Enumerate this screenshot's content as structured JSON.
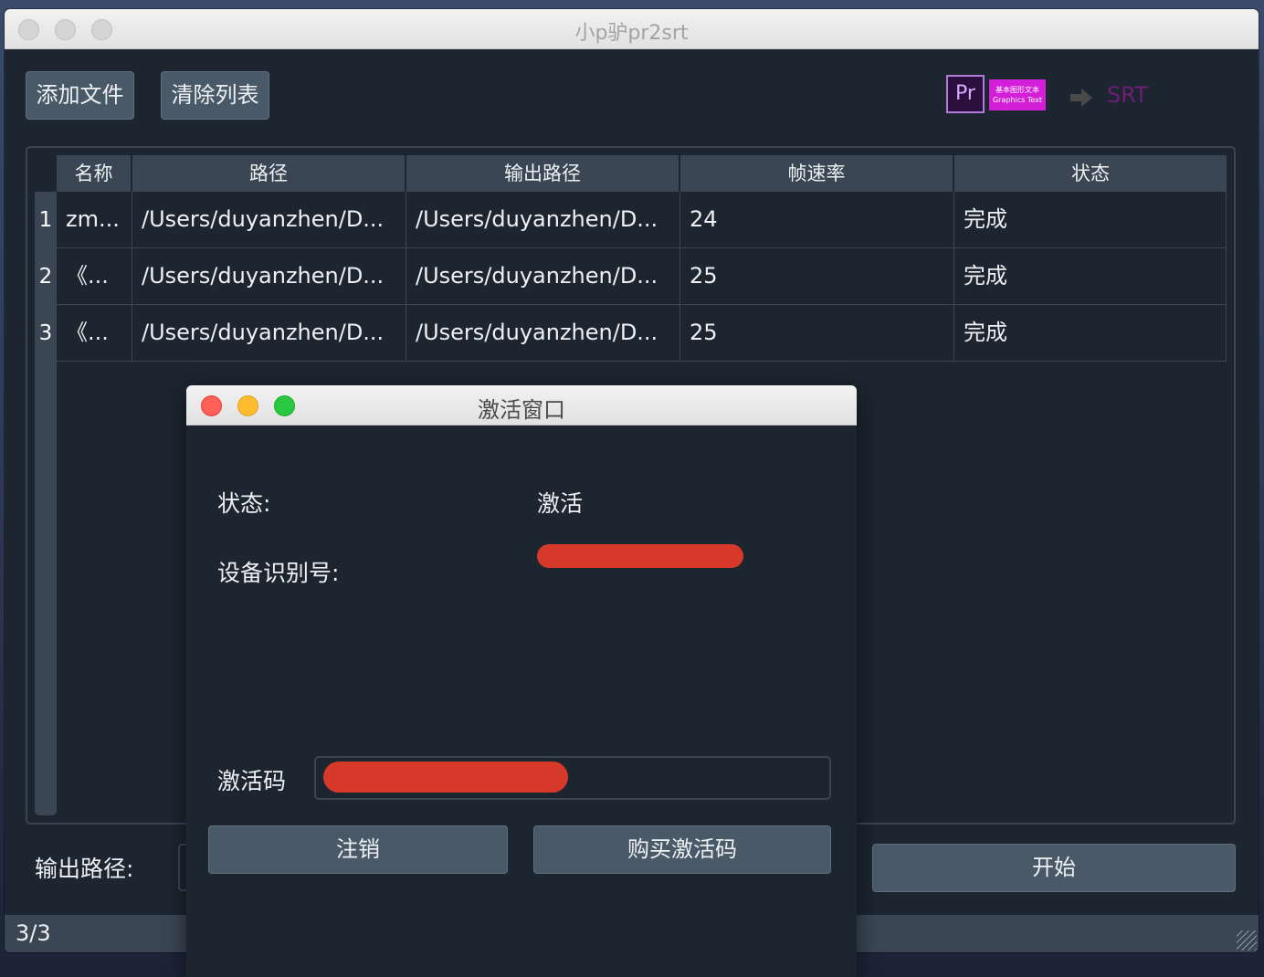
{
  "window": {
    "title": "小p驴pr2srt"
  },
  "toolbar": {
    "add_files": "添加文件",
    "clear_list": "清除列表"
  },
  "logo": {
    "pr_text": "Pr",
    "mgt_line1": "基本图形文本",
    "mgt_line2": "Graphics Text",
    "srt_text": "SRT"
  },
  "table": {
    "headers": [
      "名称",
      "路径",
      "输出路径",
      "帧速率",
      "状态"
    ],
    "rows": [
      {
        "index": "1",
        "name": "zm...",
        "path": "/Users/duyanzhen/D...",
        "output": "/Users/duyanzhen/D...",
        "fps": "24",
        "status": "完成"
      },
      {
        "index": "2",
        "name": "《...",
        "path": "/Users/duyanzhen/D...",
        "output": "/Users/duyanzhen/D...",
        "fps": "25",
        "status": "完成"
      },
      {
        "index": "3",
        "name": "《...",
        "path": "/Users/duyanzhen/D...",
        "output": "/Users/duyanzhen/D...",
        "fps": "25",
        "status": "完成"
      }
    ]
  },
  "footer": {
    "output_label": "输出路径:",
    "start": "开始",
    "status": "3/3"
  },
  "dialog": {
    "title": "激活窗口",
    "status_label": "状态:",
    "status_value": "激活",
    "device_label": "设备识别号:",
    "code_label": "激活码",
    "logout": "注销",
    "buy": "购买激活码"
  },
  "colors": {
    "background": "#1c2530",
    "panel": "#3a4654",
    "button": "#4a5968",
    "redaction": "#d6392a"
  }
}
